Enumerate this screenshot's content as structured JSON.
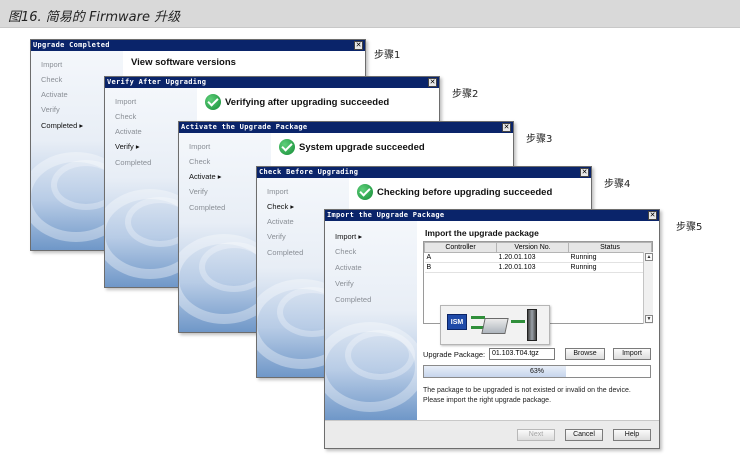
{
  "caption": "图16. 简易的 Firmware 升级",
  "steps": [
    {
      "label": "步骤5"
    },
    {
      "label": "步骤4"
    },
    {
      "label": "步骤3"
    },
    {
      "label": "步骤2"
    },
    {
      "label": "步骤1"
    }
  ],
  "dialogs": {
    "d5": {
      "title": "Upgrade Completed",
      "heading": "View software versions",
      "nav": [
        "Import",
        "Check",
        "Activate",
        "Verify",
        "Completed ▸"
      ]
    },
    "d4": {
      "title": "Verify After Upgrading",
      "heading": "Verifying after upgrading succeeded",
      "nav": [
        "Import",
        "Check",
        "Activate",
        "Verify ▸",
        "Completed"
      ]
    },
    "d3": {
      "title": "Activate the Upgrade Package",
      "heading": "System upgrade succeeded",
      "nav": [
        "Import",
        "Check",
        "Activate ▸",
        "Verify",
        "Completed"
      ]
    },
    "d2": {
      "title": "Check Before Upgrading",
      "heading": "Checking before upgrading succeeded",
      "nav": [
        "Import",
        "Check ▸",
        "Activate",
        "Verify",
        "Completed"
      ]
    },
    "d1": {
      "title": "Import the Upgrade Package",
      "heading": "Import the upgrade package",
      "nav": [
        "Import ▸",
        "Check",
        "Activate",
        "Verify",
        "Completed"
      ],
      "table": {
        "headers": [
          "Controller",
          "Version No.",
          "Status"
        ],
        "rows": [
          [
            "A",
            "1.20.01.103",
            "Running"
          ],
          [
            "B",
            "1.20.01.103",
            "Running"
          ]
        ]
      },
      "device_label": "ISM",
      "package_label": "Upgrade Package:",
      "package_value": "01.103.T04.tgz",
      "browse": "Browse",
      "import": "Import",
      "progress": 63,
      "progress_text": "63%",
      "message_line1": "The package to be upgraded is not existed or invalid on the device.",
      "message_line2": "Please import the right upgrade package.",
      "next": "Next",
      "cancel": "Cancel",
      "help": "Help"
    }
  }
}
